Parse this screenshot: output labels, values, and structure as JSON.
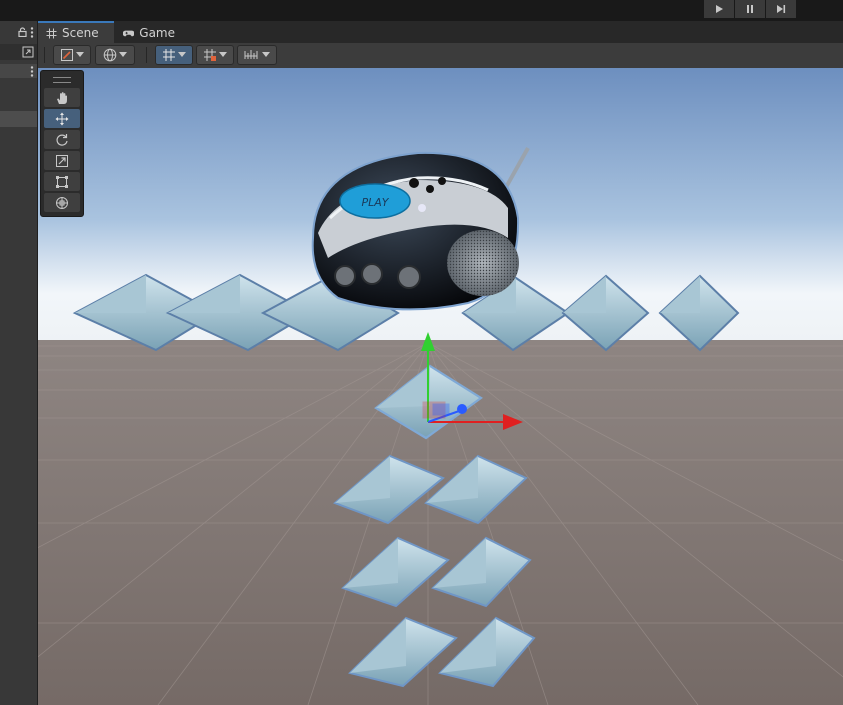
{
  "tabs": [
    {
      "label": "Scene",
      "icon": "grid-hash-icon",
      "active": true
    },
    {
      "label": "Game",
      "icon": "gamepad-icon",
      "active": false
    }
  ],
  "playbar": {
    "icons": [
      "play-icon",
      "pause-icon",
      "step-icon"
    ]
  },
  "scene_toolbar": {
    "icons": [
      "draw-mode-icon",
      "global-icon",
      "grid-snap-icon",
      "snap-increment-icon",
      "ruler-icon"
    ]
  },
  "tool_palette": {
    "tools": [
      "hand-tool-icon",
      "move-tool-icon",
      "rotate-tool-icon",
      "scale-tool-icon",
      "rect-tool-icon",
      "transform-tool-icon"
    ],
    "selected": "move-tool-icon"
  },
  "scene_object": {
    "play_label": "PLAY"
  },
  "colors": {
    "accent": "#3a79bb",
    "selected_tool": "#46607c",
    "x_axis": "#e02020",
    "y_axis": "#30d030",
    "z_axis": "#2a5cff"
  }
}
